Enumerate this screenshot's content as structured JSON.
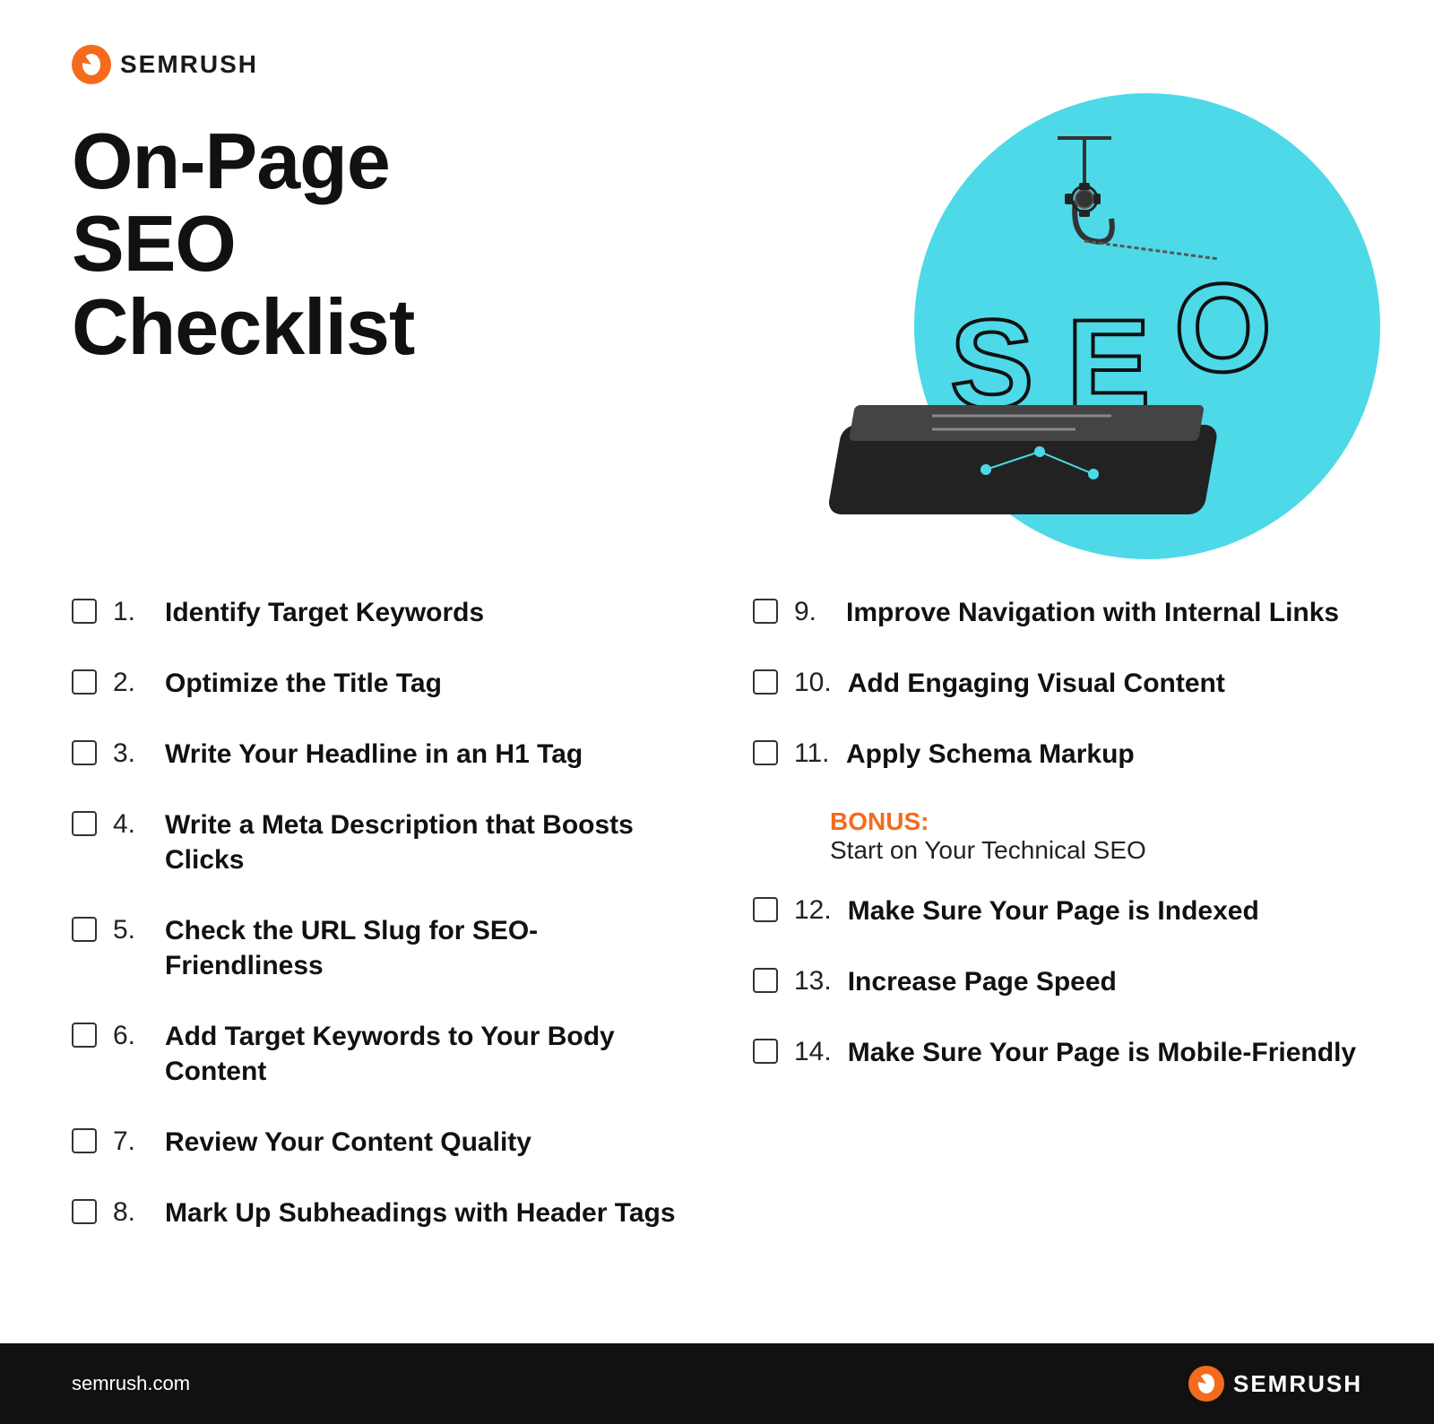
{
  "logo": {
    "text": "SEMRUSH",
    "url_text": "semrush.com"
  },
  "title": "On-Page SEO Checklist",
  "checklist_left": [
    {
      "number": "1.",
      "text": "Identify Target Keywords"
    },
    {
      "number": "2.",
      "text": "Optimize the Title Tag"
    },
    {
      "number": "3.",
      "text": "Write Your Headline in an H1 Tag"
    },
    {
      "number": "4.",
      "text": "Write a Meta Description that Boosts Clicks"
    },
    {
      "number": "5.",
      "text": "Check the URL Slug for SEO-Friendliness"
    },
    {
      "number": "6.",
      "text": "Add Target Keywords to Your Body Content"
    },
    {
      "number": "7.",
      "text": "Review Your Content Quality"
    },
    {
      "number": "8.",
      "text": "Mark Up Subheadings with Header Tags"
    }
  ],
  "checklist_right": [
    {
      "number": "9.",
      "text": "Improve Navigation with Internal Links"
    },
    {
      "number": "10.",
      "text": "Add Engaging Visual Content"
    },
    {
      "number": "11.",
      "text": "Apply Schema Markup"
    },
    {
      "number": "12.",
      "text": "Make Sure Your Page is Indexed"
    },
    {
      "number": "13.",
      "text": "Increase Page Speed"
    },
    {
      "number": "14.",
      "text": "Make Sure Your Page is Mobile-Friendly"
    }
  ],
  "bonus": {
    "label": "BONUS:",
    "text": "Start on Your Technical SEO"
  },
  "colors": {
    "orange": "#f46b1e",
    "teal": "#4dd9e8",
    "dark": "#111111",
    "white": "#ffffff"
  }
}
